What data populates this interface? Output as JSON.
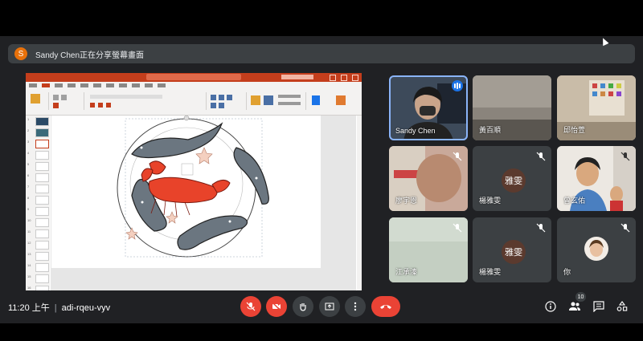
{
  "banner": {
    "avatar_letter": "S",
    "text": "Sandy Chen正在分享螢幕畫面"
  },
  "participants": [
    {
      "name": "Sandy Chen",
      "speaking": true
    },
    {
      "name": "黃百順",
      "muted": false
    },
    {
      "name": "邱怡萱",
      "muted": false
    },
    {
      "name": "廖宇恩",
      "muted": true
    },
    {
      "name": "楊雅雯",
      "muted": true,
      "avatar": "雅雯"
    },
    {
      "name": "曾玄佑",
      "muted": true
    },
    {
      "name": "江承溱",
      "muted": true
    },
    {
      "name": "楊雅雯",
      "muted": true,
      "avatar": "雅雯"
    },
    {
      "name": "你",
      "muted": true
    }
  ],
  "meeting": {
    "time": "11:20 上午",
    "code": "adi-rqeu-vyv",
    "participant_count": "10"
  },
  "controls": [
    "mic-off-icon",
    "camera-off-icon",
    "raise-hand-icon",
    "present-icon",
    "more-icon",
    "end-call-icon"
  ],
  "right_controls": [
    "info-icon",
    "people-icon",
    "chat-icon",
    "activities-icon"
  ],
  "colors": {
    "background": "#202124",
    "tile": "#3c4043",
    "red": "#ea4335",
    "speaking": "#1a73e8",
    "ppt": "#c43e1c"
  }
}
